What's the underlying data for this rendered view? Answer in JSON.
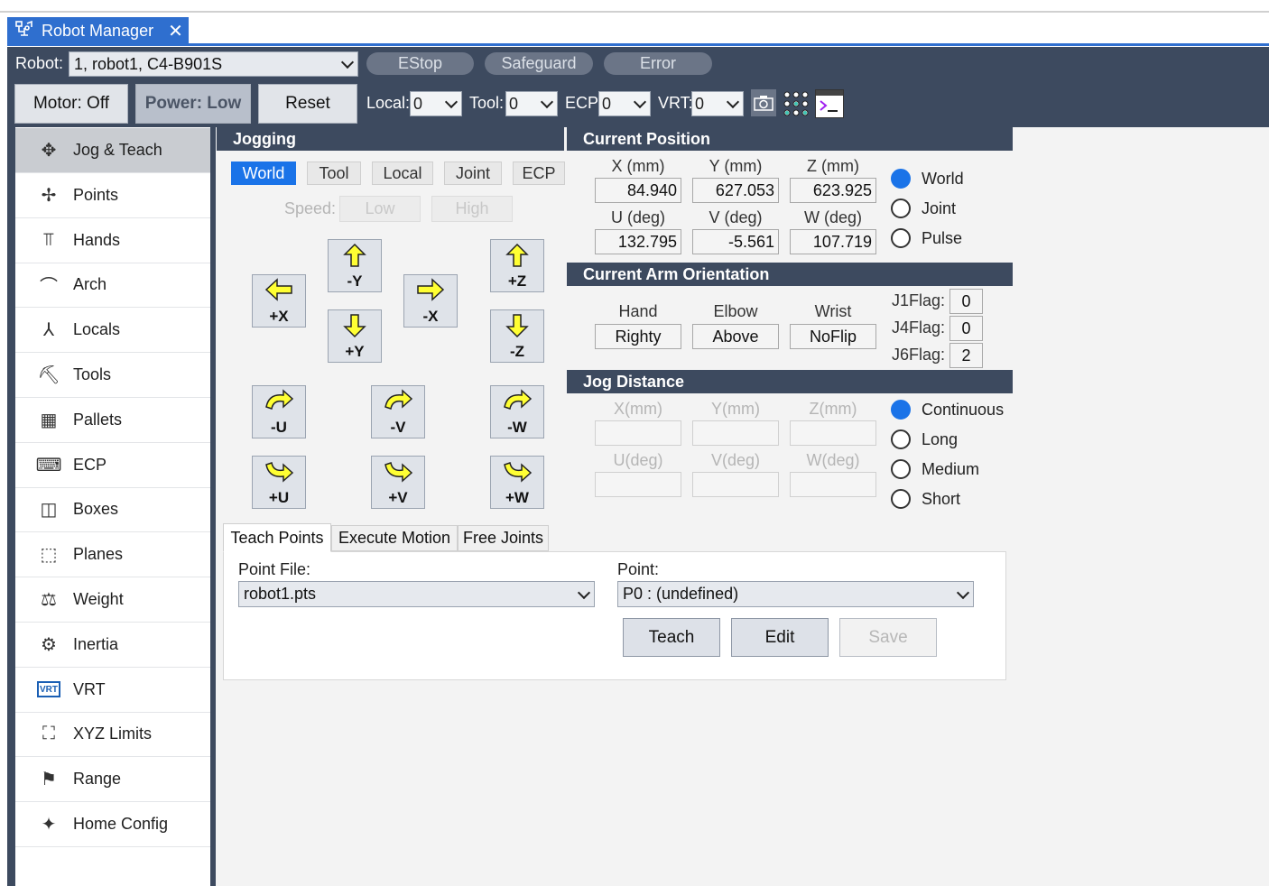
{
  "window": {
    "title": "Robot Manager",
    "close_glyph": "✕"
  },
  "robot_bar": {
    "label": "Robot:",
    "selected": "1, robot1, C4-B901S",
    "status": [
      "EStop",
      "Safeguard",
      "Error"
    ]
  },
  "toolbar": {
    "motor": "Motor: Off",
    "power": "Power: Low",
    "reset": "Reset",
    "local_label": "Local:",
    "local_value": "0",
    "tool_label": "Tool:",
    "tool_value": "0",
    "ecp_label": "ECP:",
    "ecp_value": "0",
    "vrt_label": "VRT:",
    "vrt_value": "0",
    "icons": [
      "camera-icon",
      "grid-dots-icon",
      "terminal-icon"
    ]
  },
  "sidebar": {
    "items": [
      {
        "label": "Jog & Teach",
        "icon": "move-arrows-icon",
        "glyph": "✥",
        "active": true
      },
      {
        "label": "Points",
        "icon": "points-icon",
        "glyph": "✢"
      },
      {
        "label": "Hands",
        "icon": "gripper-icon",
        "glyph": "⫪"
      },
      {
        "label": "Arch",
        "icon": "arch-icon",
        "glyph": "⌒"
      },
      {
        "label": "Locals",
        "icon": "axes-icon",
        "glyph": "⅄"
      },
      {
        "label": "Tools",
        "icon": "tool-icon",
        "glyph": "⛏"
      },
      {
        "label": "Pallets",
        "icon": "pallet-grid-icon",
        "glyph": "▦"
      },
      {
        "label": "ECP",
        "icon": "keyboard-icon",
        "glyph": "⌨"
      },
      {
        "label": "Boxes",
        "icon": "box-icon",
        "glyph": "◫"
      },
      {
        "label": "Planes",
        "icon": "plane-icon",
        "glyph": "⬚"
      },
      {
        "label": "Weight",
        "icon": "weight-icon",
        "glyph": "⚖"
      },
      {
        "label": "Inertia",
        "icon": "inertia-icon",
        "glyph": "⚙"
      },
      {
        "label": "VRT",
        "icon": "vrt-icon",
        "glyph": "VRT"
      },
      {
        "label": "XYZ Limits",
        "icon": "xyz-limits-icon",
        "glyph": "⛶"
      },
      {
        "label": "Range",
        "icon": "range-icon",
        "glyph": "⚑"
      },
      {
        "label": "Home Config",
        "icon": "home-config-icon",
        "glyph": "✦"
      }
    ]
  },
  "jogging": {
    "title": "Jogging",
    "modes": [
      "World",
      "Tool",
      "Local",
      "Joint",
      "ECP"
    ],
    "selected_mode": "World",
    "speed_label": "Speed:",
    "speed_options": [
      "Low",
      "High"
    ],
    "buttons": {
      "plus_x": "+X",
      "minus_y": "-Y",
      "minus_x": "-X",
      "plus_y": "+Y",
      "plus_z": "+Z",
      "minus_z": "-Z",
      "minus_u": "-U",
      "minus_v": "-V",
      "minus_w": "-W",
      "plus_u": "+U",
      "plus_v": "+V",
      "plus_w": "+W"
    }
  },
  "current_position": {
    "title": "Current Position",
    "labels": [
      "X (mm)",
      "Y (mm)",
      "Z (mm)",
      "U (deg)",
      "V (deg)",
      "W (deg)"
    ],
    "values": [
      "84.940",
      "627.053",
      "623.925",
      "132.795",
      "-5.561",
      "107.719"
    ],
    "display_options": [
      "World",
      "Joint",
      "Pulse"
    ],
    "selected_display": "World"
  },
  "arm_orientation": {
    "title": "Current Arm Orientation",
    "labels": [
      "Hand",
      "Elbow",
      "Wrist"
    ],
    "values": [
      "Righty",
      "Above",
      "NoFlip"
    ],
    "flags": [
      {
        "label": "J1Flag:",
        "value": "0"
      },
      {
        "label": "J4Flag:",
        "value": "0"
      },
      {
        "label": "J6Flag:",
        "value": "2"
      }
    ]
  },
  "jog_distance": {
    "title": "Jog Distance",
    "labels": [
      "X(mm)",
      "Y(mm)",
      "Z(mm)",
      "U(deg)",
      "V(deg)",
      "W(deg)"
    ],
    "options": [
      "Continuous",
      "Long",
      "Medium",
      "Short"
    ],
    "selected": "Continuous"
  },
  "tabs": {
    "items": [
      "Teach Points",
      "Execute Motion",
      "Free Joints"
    ],
    "selected": "Teach Points",
    "point_file_label": "Point File:",
    "point_file_value": "robot1.pts",
    "point_label": "Point:",
    "point_value": "P0 : (undefined)",
    "teach": "Teach",
    "edit": "Edit",
    "save": "Save"
  },
  "colors": {
    "accent": "#1a73e8",
    "frame": "#3d4a5f",
    "title_tab": "#2f6fcf",
    "arrow_fill": "#ffff33"
  }
}
